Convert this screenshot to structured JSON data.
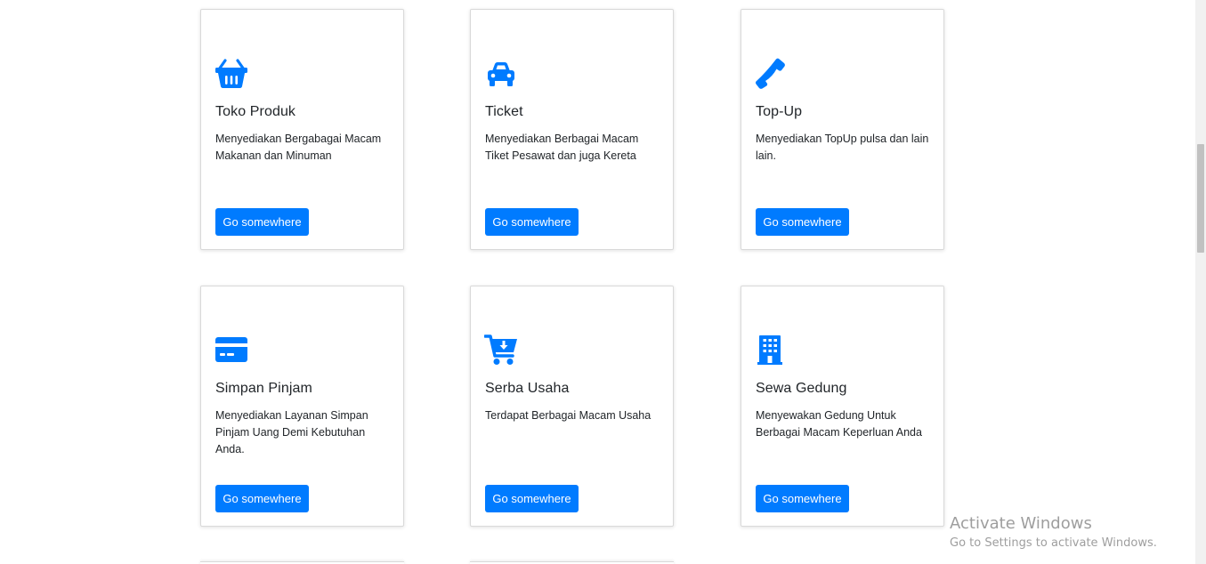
{
  "cards": [
    {
      "title": "Toko Produk",
      "text": "Menyediakan Bergabagai Macam Makanan dan Minuman",
      "button": "Go somewhere",
      "icon": "shopping-basket-icon"
    },
    {
      "title": "Ticket",
      "text": "Menyediakan Berbagai Macam Tiket Pesawat dan juga Kereta",
      "button": "Go somewhere",
      "icon": "car-icon"
    },
    {
      "title": "Top-Up",
      "text": "Menyediakan TopUp pulsa dan lain lain.",
      "button": "Go somewhere",
      "icon": "phone-icon"
    },
    {
      "title": "Simpan Pinjam",
      "text": "Menyediakan Layanan Simpan Pinjam Uang Demi Kebutuhan Anda.",
      "button": "Go somewhere",
      "icon": "credit-card-icon"
    },
    {
      "title": "Serba Usaha",
      "text": "Terdapat Berbagai Macam Usaha",
      "button": "Go somewhere",
      "icon": "cart-arrow-down-icon"
    },
    {
      "title": "Sewa Gedung",
      "text": "Menyewakan Gedung Untuk Berbagai Macam Keperluan Anda",
      "button": "Go somewhere",
      "icon": "building-icon"
    }
  ],
  "watermark": {
    "title": "Activate Windows",
    "subtitle": "Go to Settings to activate Windows."
  },
  "colors": {
    "primary": "#007bff",
    "text": "#212529",
    "watermark": "#9e9e9e"
  }
}
